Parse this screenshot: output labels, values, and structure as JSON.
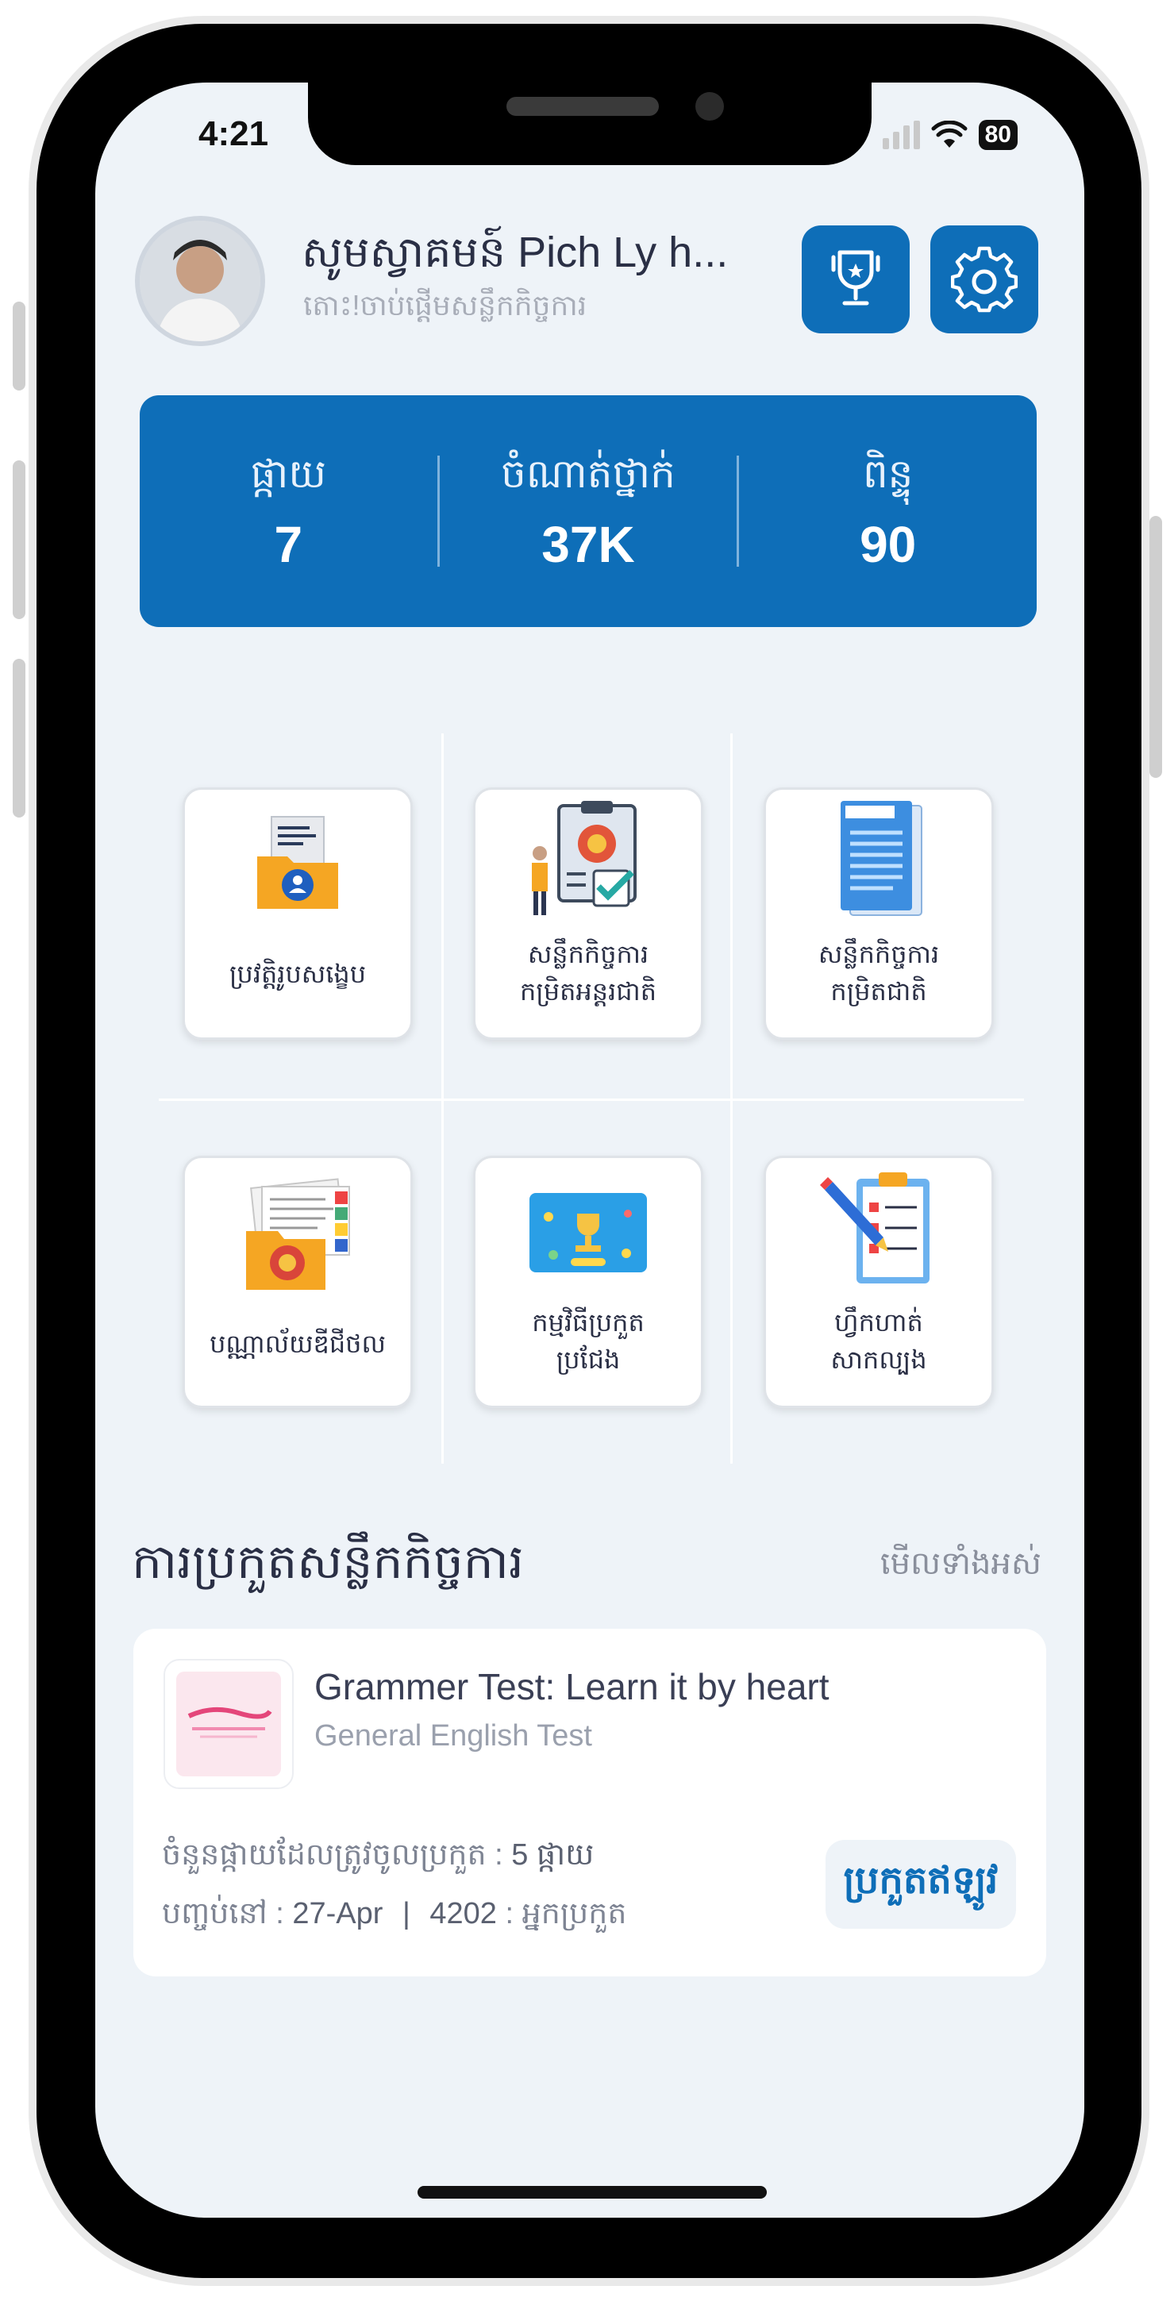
{
  "status": {
    "time": "4:21",
    "battery": "80"
  },
  "header": {
    "greeting": "សូមស្វាគមន៍ Pich Ly h...",
    "subtitle": "តោះ!ចាប់ផ្តើមសន្លឹកកិច្ចការ"
  },
  "stats": [
    {
      "label": "ផ្កាយ",
      "value": "7"
    },
    {
      "label": "ចំណាត់ថ្នាក់",
      "value": "37K"
    },
    {
      "label": "ពិន្ទុ",
      "value": "90"
    }
  ],
  "menu": [
    {
      "line1": "ប្រវត្តិរូបសង្ខេប",
      "line2": "",
      "icon": "profile-folder-icon"
    },
    {
      "line1": "សន្លឹកកិច្ចការ",
      "line2": "កម្រិតអន្តរជាតិ",
      "icon": "checklist-board-icon"
    },
    {
      "line1": "សន្លឹកកិច្ចការ",
      "line2": "កម្រិតជាតិ",
      "icon": "document-icon"
    },
    {
      "line1": "បណ្ណាល័យឌីជីថល",
      "line2": "",
      "icon": "library-folder-icon"
    },
    {
      "line1": "កម្មវិធីប្រកួត",
      "line2": "ប្រជែង",
      "icon": "trophy-screen-icon"
    },
    {
      "line1": "ហ្វឹកហាត់",
      "line2": "សាកល្បង",
      "icon": "clipboard-pencil-icon"
    }
  ],
  "section": {
    "title": "ការប្រកួតសន្លឹកកិច្ចការ",
    "see_all": "មើលទាំងអស់"
  },
  "contest": {
    "title": "Grammer Test:  Learn it by heart",
    "subtitle": "General English Test",
    "stars_label": "ចំនួនផ្កាយដែលត្រូវចូលប្រកួត : ",
    "stars_value": "5 ផ្កាយ",
    "end_label": "បញ្ចប់នៅ : ",
    "end_value": "27-Apr",
    "sep": "|",
    "participants_value": "4202",
    "participants_label": " : អ្នកប្រកួត",
    "button": "ប្រកួតឥឡូវ"
  },
  "colors": {
    "primary": "#0e6eb8",
    "background": "#eef3f8"
  }
}
